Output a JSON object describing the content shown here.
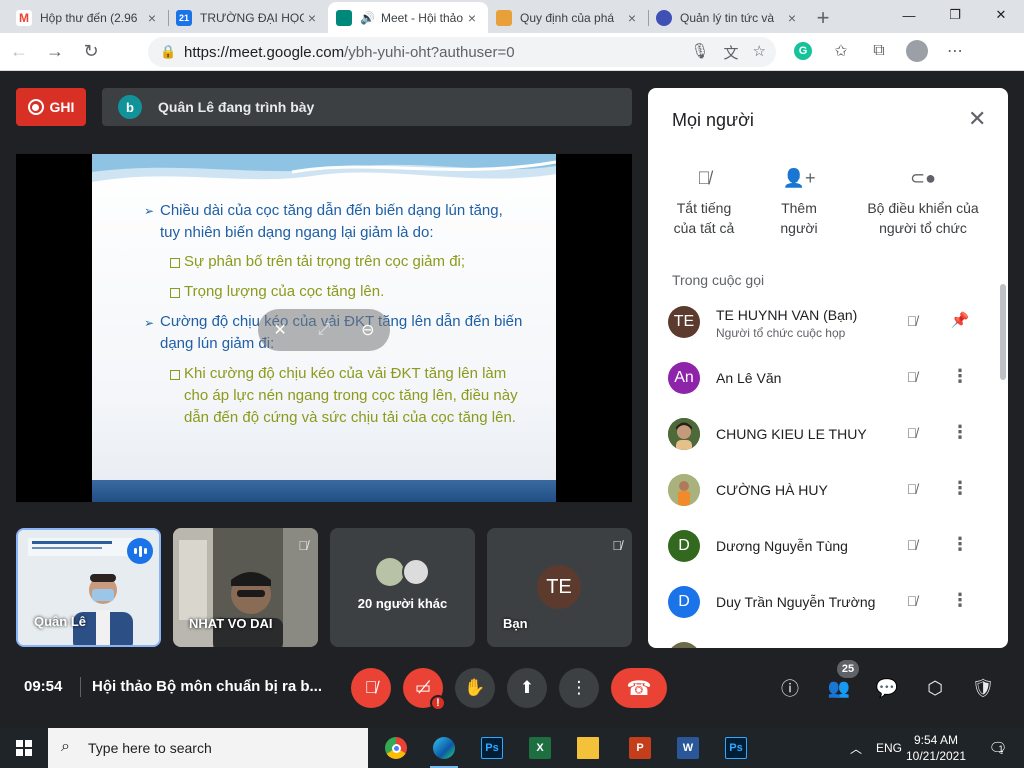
{
  "browser": {
    "tabs": [
      {
        "title": "Hộp thư đến (2.96",
        "favicon": "gmail-icon",
        "active": false
      },
      {
        "title": "TRƯỜNG ĐẠI HỌC",
        "favicon": "calendar-icon",
        "active": false
      },
      {
        "title": "Meet - Hội thảo",
        "favicon": "meet-icon",
        "active": true
      },
      {
        "title": "Quy định của phá",
        "favicon": "site-icon",
        "active": false
      },
      {
        "title": "Quản lý tin tức và",
        "favicon": "university-icon",
        "active": false
      }
    ],
    "url_host": "https://meet.google.com",
    "url_rest": "/ybh-yuhi-oht?authuser=0",
    "calendar_day": "21"
  },
  "meet": {
    "record_label": "GHI",
    "presenting_avatar": "b",
    "presenting_text": "Quân Lê đang trình bày",
    "slide": {
      "bullet1_line1": "Chiều dài của cọc tăng dẫn đến biến dạng lún tăng,",
      "bullet1_line2": "tuy nhiên biến dạng ngang lại giảm là do:",
      "sub1": "Sự phân bố trên tải trọng trên cọc giảm đi;",
      "sub2": "Trọng lượng của cọc tăng lên.",
      "bullet2_line1": "Cường độ chịu kéo của vải ĐKT tăng lên dẫn đến biến",
      "bullet2_line2": "dạng lún giảm đi:",
      "sub3_line1": "Khi cường độ chịu kéo của vải ĐKT tăng lên làm",
      "sub3_line2": "cho áp lực nén ngang trong cọc tăng lên, điều này",
      "sub3_line3": "dẫn đến độ cứng và sức chịu tải của cọc tăng lên."
    },
    "tiles": {
      "tile1_name": "Quân Lê",
      "tile2_name": "NHAT VO DAI",
      "tile3_label": "20 người khác",
      "tile4_initials": "TE",
      "tile4_name": "Bạn"
    },
    "bottom": {
      "time": "09:54",
      "title": "Hội thảo Bộ môn chuẩn bị ra b...",
      "people_count": "25"
    }
  },
  "panel": {
    "title": "Mọi người",
    "actions": [
      {
        "line1": "Tắt tiếng",
        "line2": "của tất cả"
      },
      {
        "line1": "Thêm",
        "line2": "người"
      },
      {
        "line1": "Bộ điều khiển của",
        "line2": "người tổ chức"
      }
    ],
    "section": "Trong cuộc gọi",
    "people": [
      {
        "initials": "TE",
        "name": "TE HUYNH VAN (Bạn)",
        "sub": "Người tổ chức cuộc họp",
        "color": "#5c3b2e"
      },
      {
        "initials": "An",
        "name": "An Lê Văn",
        "sub": "",
        "color": "#8e24aa"
      },
      {
        "initials": "",
        "name": "CHUNG KIEU LE THUY",
        "sub": "",
        "color": "#4a5d3a"
      },
      {
        "initials": "",
        "name": "CƯỜNG HÀ HUY",
        "sub": "",
        "color": "#9aa56b"
      },
      {
        "initials": "D",
        "name": "Dương Nguyễn Tùng",
        "sub": "",
        "color": "#33691e"
      },
      {
        "initials": "D",
        "name": "Duy Trần Nguyễn Trường",
        "sub": "",
        "color": "#1a73e8"
      }
    ]
  },
  "taskbar": {
    "search_placeholder": "Type here to search",
    "lang": "ENG",
    "time": "9:54 AM",
    "date": "10/21/2021",
    "notifications": "1"
  }
}
